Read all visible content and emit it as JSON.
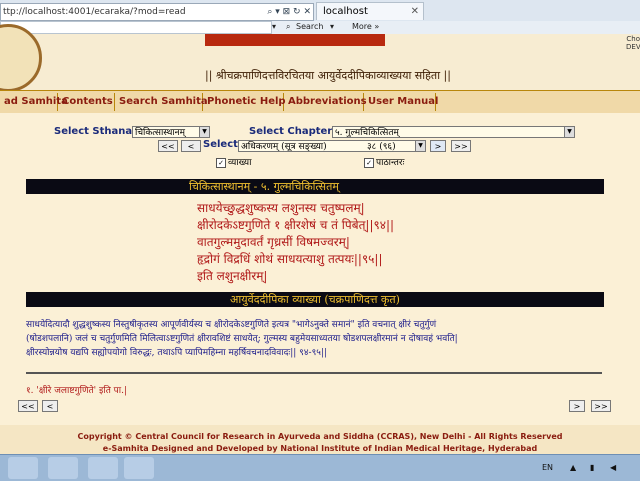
{
  "browser": {
    "address": "ttp://localhost:4001/ecaraka/?mod=read",
    "tab_title": "localhost",
    "toolbar": {
      "search_label": "Search",
      "more_label": "More »"
    }
  },
  "header": {
    "subtitle": "|| श्रीचक्रपाणिदत्तविरचितया आयुर्वेददीपिकाव्याख्यया सहिता ||",
    "corner_text": [
      "Cho",
      "DEV"
    ]
  },
  "nav": {
    "items": [
      "ad Samhita",
      "Contents",
      "Search Samhita",
      "Phonetic Help",
      "Abbreviations",
      "User Manual"
    ]
  },
  "controls": {
    "sthana_label": "Select Sthana",
    "sthana_value": "चिकित्सास्थानम्",
    "chapter_label": "Select Chapter",
    "chapter_value": "५. गुल्मचिकित्सितम्",
    "select_label": "Select",
    "adhikarana_value": "अधिकरणम् (सूत्र सङ्ख्या)",
    "sutra_value": "३८ (९६)",
    "prev_all": "<<",
    "prev": "<",
    "next": ">",
    "next_all": ">>",
    "vyakhya_label": "व्याख्या",
    "pathantara_label": "पाठान्तरः"
  },
  "content": {
    "chapter_header": "चिकित्सास्थानम्          -          ५. गुल्मचिकित्सितम्",
    "verses": [
      "साधयेच्छुद्धशुष्कस्य लशुनस्य चतुष्पलम्|",
      "क्षीरोदकेऽष्टगुणिते १ क्षीरशेषं च तं पिबेत्||९४||",
      "वातगुल्ममुदावर्तं गृध्रसीं विषमज्वरम्|",
      "हृद्रोगं विद्रधिं शोथं साधयत्याशु तत्पयः||९५||",
      "इति लशुनक्षीरम्|"
    ],
    "commentary_header": "आयुर्वेददीपिका व्याख्या (चक्रपाणिदत्त कृत)",
    "commentary": [
      "साधयेदित्यादौ शुद्धशुष्कस्य निस्तुषीकृतस्य आपूर्णवीर्यस्य च क्षीरोदकेऽष्टगुणिते इत्यत्र \"भागेऽनुक्ते समानं\" इति वचनात् क्षीरं चतुर्गुणं",
      "(षोडशपलानि) जलं च चतुर्गुणमिति मिलित्वाऽष्टगुणितं क्षीरावशिष्टं साधयेत्; गुल्मस्य बहुमेयसाध्यतया षोडशपलक्षीरमानं न दोषावहं भवति|",
      "क्षीरस्योन्नयोष यद्यपि सह्योपयोगो विरुद्धः, तथाऽपि प्यापिमहिम्ना महर्षिवचनादविवादः|| ९४-९५||"
    ],
    "footnote": "१. 'क्षीरे जलाष्टगुणिते' इति पा.|"
  },
  "footer": {
    "line1": "Copyright © Central Council for Research in Ayurveda and Siddha (CCRAS), New Delhi - All Rights Reserved",
    "line2": "e-Samhita Designed and Developed by National Institute of Indian Medical Heritage, Hyderabad"
  },
  "taskbar": {
    "lang": "EN"
  },
  "colors": {
    "nav_text": "#8a1c0f",
    "verse_text": "#b01818",
    "commentary_text": "#1a1a8a",
    "header_bar": "#0a0a14",
    "header_text": "#f0c030"
  }
}
